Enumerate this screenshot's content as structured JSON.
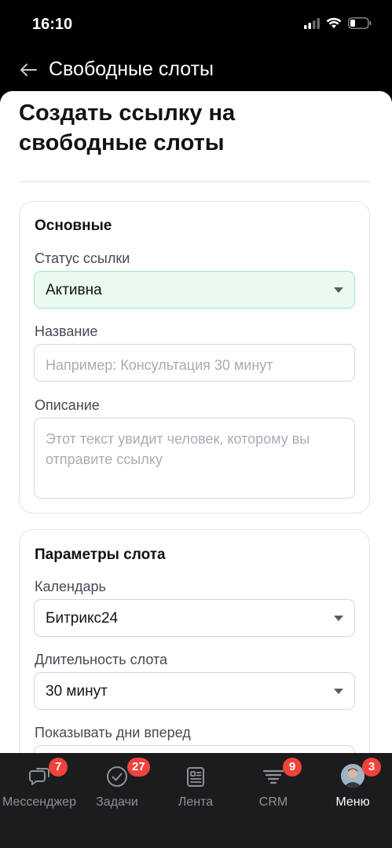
{
  "status_bar": {
    "time": "16:10"
  },
  "nav": {
    "title": "Свободные слоты"
  },
  "sheet": {
    "title": "Создать ссылку на свободные слоты"
  },
  "main_card": {
    "heading": "Основные",
    "status": {
      "label": "Статус ссылки",
      "value": "Активна"
    },
    "name": {
      "label": "Название",
      "placeholder": "Например: Консультация 30 минут"
    },
    "description": {
      "label": "Описание",
      "placeholder": "Этот текст увидит человек, которому вы отправите ссылку"
    }
  },
  "slot_card": {
    "heading": "Параметры слота",
    "calendar": {
      "label": "Календарь",
      "value": "Битрикс24"
    },
    "duration": {
      "label": "Длительность слота",
      "value": "30 минут"
    },
    "days_ahead": {
      "label": "Показывать дни вперед"
    }
  },
  "tabbar": {
    "tabs": [
      {
        "label": "Мессенджер",
        "badge": "7",
        "icon": "messenger-icon"
      },
      {
        "label": "Задачи",
        "badge": "27",
        "icon": "tasks-icon"
      },
      {
        "label": "Лента",
        "badge": "",
        "icon": "feed-icon"
      },
      {
        "label": "CRM",
        "badge": "9",
        "icon": "crm-icon"
      },
      {
        "label": "Меню",
        "badge": "3",
        "icon": "avatar"
      }
    ]
  },
  "colors": {
    "accent_green_bg": "#eafaf1",
    "badge": "#f0433c",
    "tab_bg": "#1c1c1e"
  }
}
